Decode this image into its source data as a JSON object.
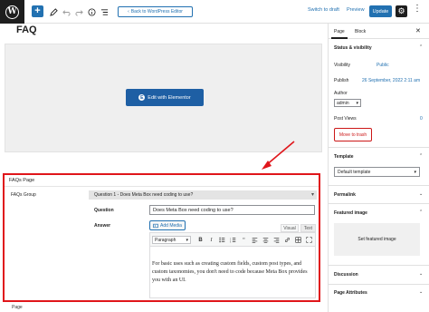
{
  "header": {
    "back_label": "Back to WordPress Editor",
    "switch_draft": "Switch to draft",
    "preview": "Preview",
    "update": "Update",
    "add_symbol": "+",
    "settings_symbol": "⚙",
    "more_symbol": "⋮"
  },
  "editor": {
    "title": "FAQ",
    "elementor_button": "Edit with Elementor"
  },
  "metabox": {
    "title": "FAQs Page",
    "group_label": "FAQs Group",
    "group_item_title": "Question 1 - Does Meta Box need coding to use?",
    "question_label": "Question",
    "question_value": "Does Meta Box need coding to use?",
    "answer_label": "Answer",
    "add_media": "Add Media",
    "tab_visual": "Visual",
    "tab_text": "Text",
    "format_select": "Paragraph",
    "answer_text": "For basic uses such as creating custom fields, custom post types, and custom taxonomies, you don't need to code because Meta Box provides you with an UI."
  },
  "footer": {
    "breadcrumb": "Page"
  },
  "sidebar": {
    "tab_page": "Page",
    "tab_block": "Block",
    "status_title": "Status & visibility",
    "visibility_label": "Visibility",
    "visibility_value": "Public",
    "publish_label": "Publish",
    "publish_value": "26 September, 2022 2:11 am",
    "author_label": "Author",
    "author_value": "admin",
    "post_views_label": "Post Views",
    "post_views_value": "0",
    "trash": "Move to trash",
    "template_title": "Template",
    "template_value": "Default template",
    "permalink_title": "Permalink",
    "featured_title": "Featured image",
    "featured_button": "Set featured image",
    "discussion_title": "Discussion",
    "page_attributes_title": "Page Attributes"
  },
  "colors": {
    "accent": "#2271b1",
    "highlight_border": "#e0161b",
    "elementor_button": "#1e5fa4",
    "trash": "#cc1818"
  }
}
